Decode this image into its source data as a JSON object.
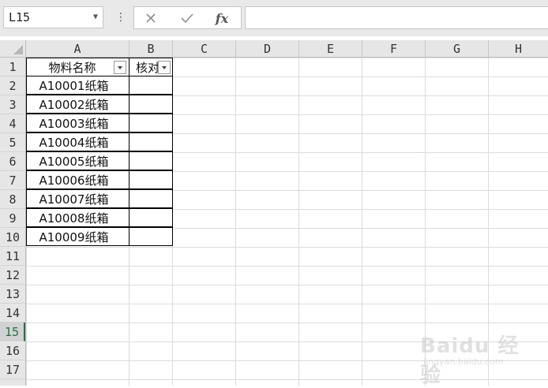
{
  "formula_bar": {
    "name_box": "L15",
    "fx_label": "fx",
    "formula": ""
  },
  "columns": [
    "A",
    "B",
    "C",
    "D",
    "E",
    "F",
    "G",
    "H"
  ],
  "rows": [
    "1",
    "2",
    "3",
    "4",
    "5",
    "6",
    "7",
    "8",
    "9",
    "10",
    "11",
    "12",
    "13",
    "14",
    "15",
    "16",
    "17"
  ],
  "selected_row": "15",
  "table": {
    "headers": [
      "物料名称",
      "核对"
    ],
    "items": [
      "A10001纸箱",
      "A10002纸箱",
      "A10003纸箱",
      "A10004纸箱",
      "A10005纸箱",
      "A10006纸箱",
      "A10007纸箱",
      "A10008纸箱",
      "A10009纸箱"
    ]
  },
  "watermark": {
    "title": "Baidu 经验",
    "url": "jingyan.baidu.com"
  }
}
